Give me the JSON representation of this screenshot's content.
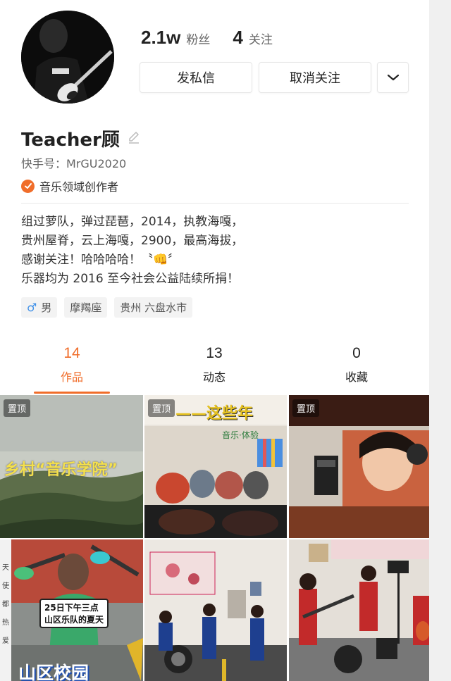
{
  "profile": {
    "followers_count": "2.1w",
    "followers_label": "粉丝",
    "following_count": "4",
    "following_label": "关注",
    "name": "Teacher顾",
    "kuaishou_id": "快手号：MrGU2020",
    "creator_label": "音乐领域创作者",
    "bio_lines": [
      "组过萝队，弹过琵琶，2014，执教海嘎，",
      "贵州屋脊，云上海嘎，2900，最高海拔，",
      "感谢关注！哈哈哈哈！〝👊〞",
      "乐器均为 2016 至今社会公益陆续所捐！"
    ],
    "tags": {
      "gender": "男",
      "zodiac": "摩羯座",
      "location": "贵州 六盘水市"
    }
  },
  "actions": {
    "message_label": "发私信",
    "unfollow_label": "取消关注"
  },
  "tabs": [
    {
      "count": "14",
      "label": "作品"
    },
    {
      "count": "13",
      "label": "动态"
    },
    {
      "count": "0",
      "label": "收藏"
    }
  ],
  "videos": {
    "pinned_label": "置顶",
    "v1_caption": "乡村“音乐学院”",
    "v2_title": "——这些年",
    "v2_sign": "音乐·体验",
    "v4_side": "天使都热爱",
    "v4_box1": "25日下午三点",
    "v4_box2": "山区乐队的夏天",
    "v4_title": "山区校园"
  },
  "colors": {
    "accent": "#f06d2a"
  }
}
